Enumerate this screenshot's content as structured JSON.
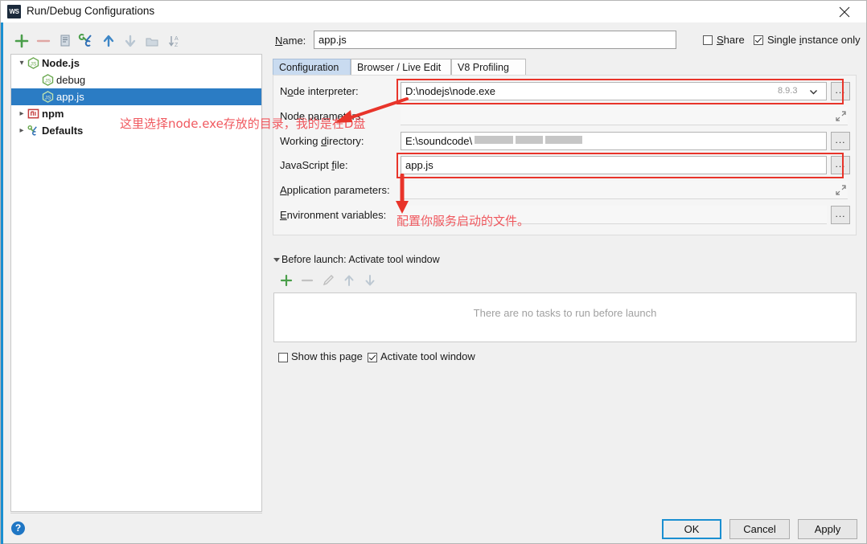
{
  "window": {
    "title": "Run/Debug Configurations",
    "app_icon": "WS",
    "close_icon": "close-icon"
  },
  "left_toolbar": {
    "buttons": [
      {
        "name": "add-configuration",
        "icon": "plus-icon",
        "enabled": true
      },
      {
        "name": "remove-configuration",
        "icon": "minus-icon",
        "enabled": false
      },
      {
        "name": "copy-configuration",
        "icon": "copy-icon",
        "enabled": false
      },
      {
        "name": "edit-templates",
        "icon": "wrench-icon",
        "enabled": true
      },
      {
        "name": "move-up",
        "icon": "arrow-up-icon",
        "enabled": true
      },
      {
        "name": "move-down",
        "icon": "arrow-down-icon",
        "enabled": false
      },
      {
        "name": "move-into-folder",
        "icon": "folder-icon",
        "enabled": false
      },
      {
        "name": "sort-alphabetically",
        "icon": "sort-az-icon",
        "enabled": false
      }
    ]
  },
  "tree": {
    "items": [
      {
        "label": "Node.js",
        "icon": "nodejs-icon",
        "indent": 0,
        "twisty": "expanded",
        "bold": true,
        "selected": false
      },
      {
        "label": "debug",
        "icon": "nodejs-icon",
        "indent": 1,
        "twisty": "none",
        "bold": false,
        "selected": false
      },
      {
        "label": "app.js",
        "icon": "nodejs-icon",
        "indent": 1,
        "twisty": "none",
        "bold": false,
        "selected": true
      },
      {
        "label": "npm",
        "icon": "npm-icon",
        "indent": 0,
        "twisty": "collapsed",
        "bold": true,
        "selected": false
      },
      {
        "label": "Defaults",
        "icon": "wrench-icon",
        "indent": 0,
        "twisty": "collapsed",
        "bold": true,
        "selected": false
      }
    ]
  },
  "name_row": {
    "label": "Name:",
    "value": "app.js",
    "share": {
      "label": "Share",
      "checked": false
    },
    "single_instance": {
      "label": "Single instance only",
      "checked": true
    }
  },
  "tabs": [
    {
      "label": "Configuration",
      "active": true
    },
    {
      "label": "Browser / Live Edit",
      "active": false
    },
    {
      "label": "V8 Profiling",
      "active": false
    }
  ],
  "fields": {
    "node_interpreter": {
      "label": "Node interpreter:",
      "value": "D:\\nodejs\\node.exe",
      "version": "8.9.3",
      "browse": "...",
      "highlighted": true
    },
    "node_parameters": {
      "label": "Node parameters:",
      "value": "",
      "expand_icon": "expand-icon"
    },
    "working_directory": {
      "label": "Working directory:",
      "value": "E:\\soundcode\\",
      "redacted": true,
      "browse": "..."
    },
    "javascript_file": {
      "label": "JavaScript file:",
      "value": "app.js",
      "browse": "...",
      "highlighted": true
    },
    "application_parameters": {
      "label": "Application parameters:",
      "value": "",
      "expand_icon": "expand-icon"
    },
    "environment_variables": {
      "label": "Environment variables:",
      "value": "",
      "browse": "..."
    }
  },
  "before_launch": {
    "title": "Before launch: Activate tool window",
    "empty_text": "There are no tasks to run before launch",
    "toolbar": [
      {
        "name": "add-task",
        "icon": "plus-icon",
        "enabled": true
      },
      {
        "name": "remove-task",
        "icon": "minus-icon",
        "enabled": false
      },
      {
        "name": "edit-task",
        "icon": "pencil-icon",
        "enabled": false
      },
      {
        "name": "task-move-up",
        "icon": "arrow-up-icon",
        "enabled": false
      },
      {
        "name": "task-move-down",
        "icon": "arrow-down-icon",
        "enabled": false
      }
    ],
    "show_this_page": {
      "label": "Show this page",
      "checked": false
    },
    "activate_tool_window": {
      "label": "Activate tool window",
      "checked": true
    }
  },
  "footer": {
    "help_icon": "?",
    "ok": "OK",
    "cancel": "Cancel",
    "apply": "Apply"
  },
  "annotations": [
    {
      "text": "这里选择node.exe存放的目录，我的是在D盘",
      "color": "#ef4b52"
    },
    {
      "text": "配置你服务启动的文件。",
      "color": "#ef4b52"
    }
  ],
  "colors": {
    "accent": "#1a8fd1",
    "selection": "#2b7cc4",
    "annotation": "#ef4b52",
    "highlight_box": "#e8342a"
  }
}
